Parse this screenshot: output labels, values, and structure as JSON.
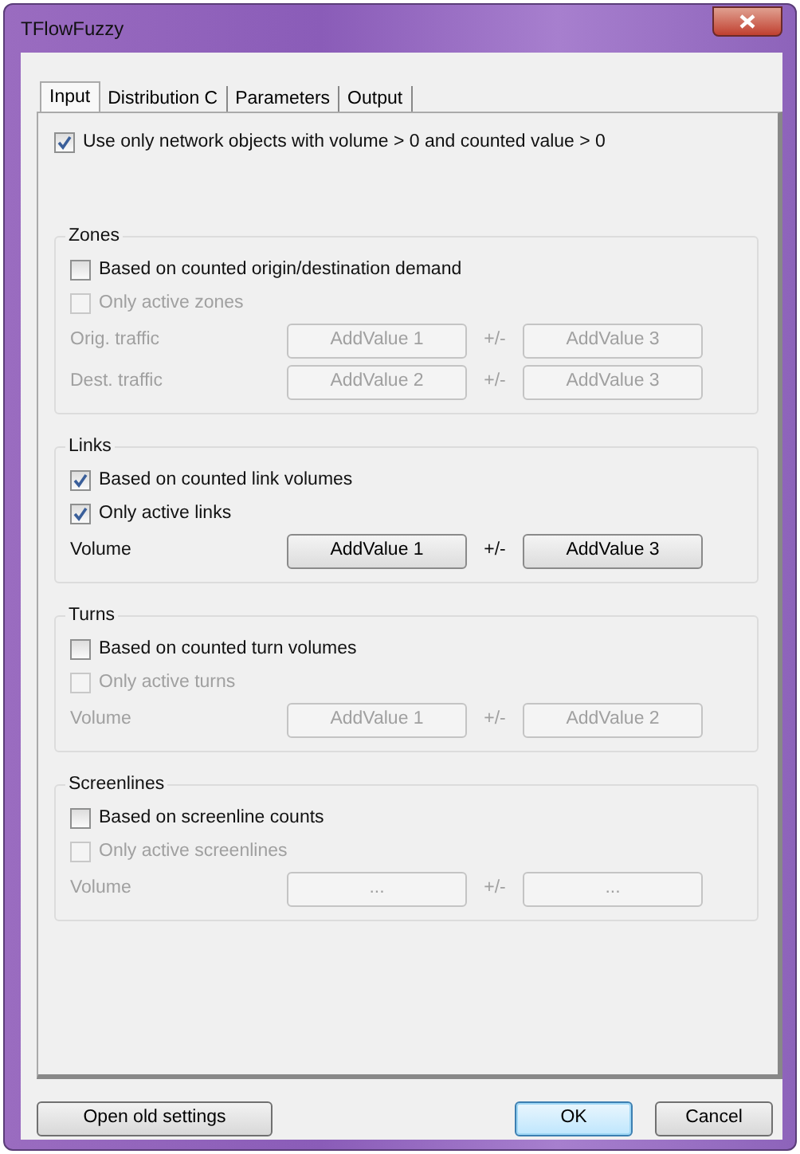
{
  "window": {
    "title": "TFlowFuzzy"
  },
  "tabs": [
    {
      "label": "Input",
      "selected": true
    },
    {
      "label": "Distribution C",
      "selected": false
    },
    {
      "label": "Parameters",
      "selected": false
    },
    {
      "label": "Output",
      "selected": false
    }
  ],
  "main_option": {
    "label": "Use only network objects with volume > 0 and counted value > 0",
    "checked": true
  },
  "groups": [
    {
      "title": "Zones",
      "checkboxes": [
        {
          "label": "Based on counted origin/destination demand",
          "checked": false,
          "disabled": false
        },
        {
          "label": "Only active zones",
          "checked": false,
          "disabled": true
        }
      ],
      "rows": [
        {
          "label": "Orig. traffic",
          "disabled": true,
          "value_button": "AddValue 1",
          "separator": "+/-",
          "tolerance_button": "AddValue 3"
        },
        {
          "label": "Dest. traffic",
          "disabled": true,
          "value_button": "AddValue 2",
          "separator": "+/-",
          "tolerance_button": "AddValue 3"
        }
      ]
    },
    {
      "title": "Links",
      "checkboxes": [
        {
          "label": "Based on counted link volumes",
          "checked": true,
          "disabled": false
        },
        {
          "label": "Only active links",
          "checked": true,
          "disabled": false
        }
      ],
      "rows": [
        {
          "label": "Volume",
          "disabled": false,
          "value_button": "AddValue 1",
          "separator": "+/-",
          "tolerance_button": "AddValue 3"
        }
      ]
    },
    {
      "title": "Turns",
      "checkboxes": [
        {
          "label": "Based on counted turn volumes",
          "checked": false,
          "disabled": false
        },
        {
          "label": "Only active turns",
          "checked": false,
          "disabled": true
        }
      ],
      "rows": [
        {
          "label": "Volume",
          "disabled": true,
          "value_button": "AddValue 1",
          "separator": "+/-",
          "tolerance_button": "AddValue 2"
        }
      ]
    },
    {
      "title": "Screenlines",
      "checkboxes": [
        {
          "label": "Based on screenline counts",
          "checked": false,
          "disabled": false
        },
        {
          "label": "Only active screenlines",
          "checked": false,
          "disabled": true
        }
      ],
      "rows": [
        {
          "label": "Volume",
          "disabled": true,
          "value_button": "...",
          "separator": "+/-",
          "tolerance_button": "..."
        }
      ]
    }
  ],
  "footer": {
    "left_button": "Open old settings",
    "ok_button": "OK",
    "cancel_button": "Cancel"
  }
}
